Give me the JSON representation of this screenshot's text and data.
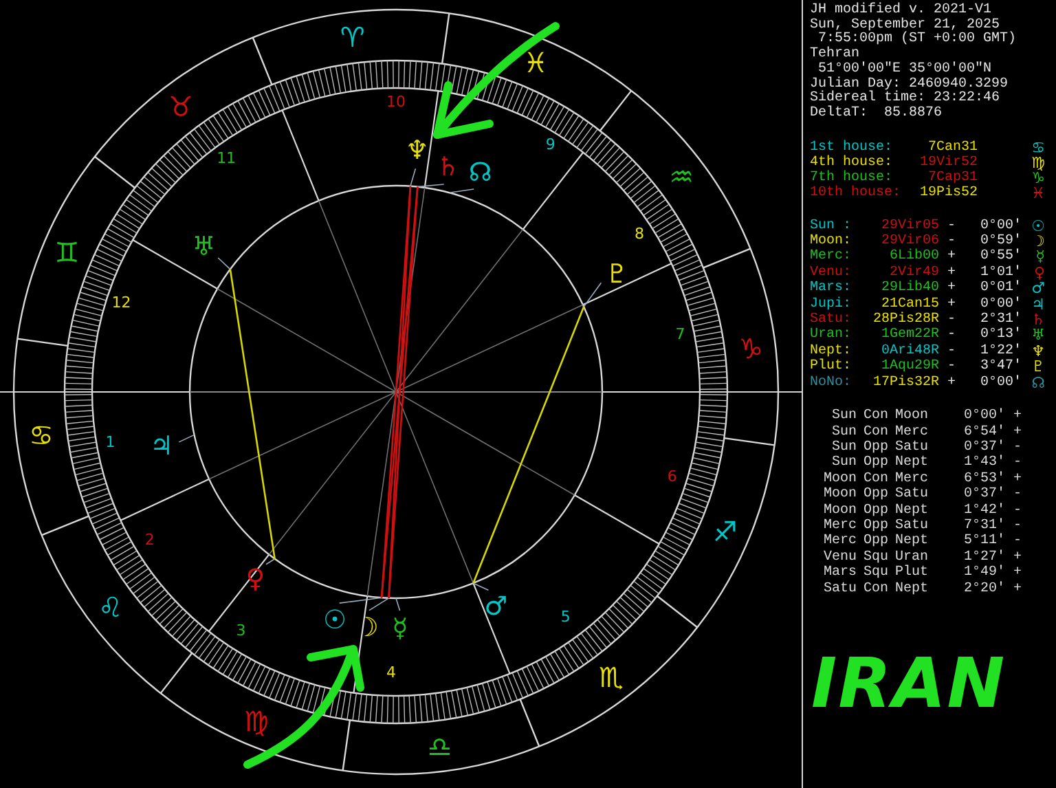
{
  "header": [
    "JH modified v. 2021-V1",
    "Sun, September 21, 2025",
    " 7:55:00pm (ST +0:00 GMT)",
    "Tehran",
    " 51°00'00\"E 35°00'00\"N",
    "Julian Day: 2460940.3299",
    "Sidereal time: 23:22:46",
    "DeltaT:  85.8876"
  ],
  "houses": [
    {
      "label": "1st house:",
      "position": {
        "text": "7Can31",
        "color": "#e8e000"
      },
      "glyph": "♋",
      "color": "#00c8c8"
    },
    {
      "label": "4th house:",
      "position": {
        "text": "19Vir52",
        "color": "#d01010"
      },
      "glyph": "♍",
      "color": "#e8e000"
    },
    {
      "label": "7th house:",
      "position": {
        "text": "7Cap31",
        "color": "#d01010"
      },
      "glyph": "♑",
      "color": "#20c020"
    },
    {
      "label": "10th house:",
      "position": {
        "text": "19Pis52",
        "color": "#e8e000"
      },
      "glyph": "♓",
      "color": "#d01010"
    }
  ],
  "planets": [
    {
      "name": "Sun :",
      "position": {
        "text": "29Vir05",
        "color": "#d01010"
      },
      "motion": "-",
      "offset": "0°00'",
      "glyph": "☉",
      "color": "#00c8c8"
    },
    {
      "name": "Moon:",
      "position": {
        "text": "29Vir06",
        "color": "#d01010"
      },
      "motion": "-",
      "offset": "0°59'",
      "glyph": "☽",
      "color": "#e8e000"
    },
    {
      "name": "Merc:",
      "position": {
        "text": "6Lib00",
        "color": "#20c020"
      },
      "motion": "+",
      "offset": "0°55'",
      "glyph": "☿",
      "color": "#20c020"
    },
    {
      "name": "Venu:",
      "position": {
        "text": "2Vir49",
        "color": "#d01010"
      },
      "motion": "+",
      "offset": "1°01'",
      "glyph": "♀",
      "color": "#d01010"
    },
    {
      "name": "Mars:",
      "position": {
        "text": "29Lib40",
        "color": "#20c020"
      },
      "motion": "+",
      "offset": "0°01'",
      "glyph": "♂",
      "color": "#00c8c8"
    },
    {
      "name": "Jupi:",
      "position": {
        "text": "21Can15",
        "color": "#e8e000"
      },
      "motion": "+",
      "offset": "0°00'",
      "glyph": "♃",
      "color": "#00c8c8"
    },
    {
      "name": "Satu:",
      "position": {
        "text": "28Pis28R",
        "color": "#e8e000"
      },
      "motion": "-",
      "offset": "2°31'",
      "glyph": "♄",
      "color": "#d01010"
    },
    {
      "name": "Uran:",
      "position": {
        "text": "1Gem22R",
        "color": "#20c020"
      },
      "motion": "-",
      "offset": "0°13'",
      "glyph": "♅",
      "color": "#20c020"
    },
    {
      "name": "Nept:",
      "position": {
        "text": "0Ari48R",
        "color": "#00c8c8"
      },
      "motion": "-",
      "offset": "1°22'",
      "glyph": "♆",
      "color": "#e8e000"
    },
    {
      "name": "Plut:",
      "position": {
        "text": "1Aqu29R",
        "color": "#20c020"
      },
      "motion": "-",
      "offset": "3°47'",
      "glyph": "♇",
      "color": "#e8e000"
    },
    {
      "name": "NoNo:",
      "position": {
        "text": "17Pis32R",
        "color": "#e8e000"
      },
      "motion": "+",
      "offset": "0°00'",
      "glyph": "☊",
      "color": "#2f8f9f"
    }
  ],
  "aspects": [
    {
      "first": "Sun",
      "type": "Con",
      "second": "Moon",
      "orb": "0°00'",
      "sign": "+"
    },
    {
      "first": "Sun",
      "type": "Con",
      "second": "Merc",
      "orb": "6°54'",
      "sign": "+"
    },
    {
      "first": "Sun",
      "type": "Opp",
      "second": "Satu",
      "orb": "0°37'",
      "sign": "-"
    },
    {
      "first": "Sun",
      "type": "Opp",
      "second": "Nept",
      "orb": "1°43'",
      "sign": "-"
    },
    {
      "first": "Moon",
      "type": "Con",
      "second": "Merc",
      "orb": "6°53'",
      "sign": "+"
    },
    {
      "first": "Moon",
      "type": "Opp",
      "second": "Satu",
      "orb": "0°37'",
      "sign": "-"
    },
    {
      "first": "Moon",
      "type": "Opp",
      "second": "Nept",
      "orb": "1°42'",
      "sign": "-"
    },
    {
      "first": "Merc",
      "type": "Opp",
      "second": "Satu",
      "orb": "7°31'",
      "sign": "-"
    },
    {
      "first": "Merc",
      "type": "Opp",
      "second": "Nept",
      "orb": "5°11'",
      "sign": "-"
    },
    {
      "first": "Venu",
      "type": "Squ",
      "second": "Uran",
      "orb": "1°27'",
      "sign": "+"
    },
    {
      "first": "Mars",
      "type": "Squ",
      "second": "Plut",
      "orb": "1°49'",
      "sign": "+"
    },
    {
      "first": "Satu",
      "type": "Con",
      "second": "Nept",
      "orb": "2°20'",
      "sign": "+"
    }
  ],
  "wheel": {
    "signs": [
      {
        "glyph": "♈",
        "color": "#00c8c8"
      },
      {
        "glyph": "♉",
        "color": "#d01010"
      },
      {
        "glyph": "♊",
        "color": "#20c020"
      },
      {
        "glyph": "♋",
        "color": "#e8e000"
      },
      {
        "glyph": "♌",
        "color": "#00c8c8"
      },
      {
        "glyph": "♍",
        "color": "#d01010"
      },
      {
        "glyph": "♎",
        "color": "#20c020"
      },
      {
        "glyph": "♏",
        "color": "#e8e000"
      },
      {
        "glyph": "♐",
        "color": "#00c8c8"
      },
      {
        "glyph": "♑",
        "color": "#d01010"
      },
      {
        "glyph": "♒",
        "color": "#20c020"
      },
      {
        "glyph": "♓",
        "color": "#e8e000"
      }
    ],
    "houses": [
      {
        "number": "1",
        "color": "#00c8c8"
      },
      {
        "number": "2",
        "color": "#d01010"
      },
      {
        "number": "3",
        "color": "#20c020"
      },
      {
        "number": "4",
        "color": "#e8e000"
      },
      {
        "number": "5",
        "color": "#00c8c8"
      },
      {
        "number": "6",
        "color": "#d01010"
      },
      {
        "number": "7",
        "color": "#20c020"
      },
      {
        "number": "8",
        "color": "#e8e000"
      },
      {
        "number": "9",
        "color": "#00c8c8"
      },
      {
        "number": "10",
        "color": "#d01010"
      },
      {
        "number": "11",
        "color": "#20c020"
      },
      {
        "number": "12",
        "color": "#e8e000"
      }
    ],
    "planets": [
      {
        "glyph": "☉",
        "color": "#00c8c8"
      },
      {
        "glyph": "☽",
        "color": "#e8e000"
      },
      {
        "glyph": "☿",
        "color": "#20c020"
      },
      {
        "glyph": "♀",
        "color": "#d01010"
      },
      {
        "glyph": "♂",
        "color": "#00c8c8"
      },
      {
        "glyph": "♃",
        "color": "#00c8c8"
      },
      {
        "glyph": "♄",
        "color": "#d01010"
      },
      {
        "glyph": "♅",
        "color": "#20c020"
      },
      {
        "glyph": "♆",
        "color": "#e8e000"
      },
      {
        "glyph": "♇",
        "color": "#e8e000"
      },
      {
        "glyph": "☊",
        "color": "#00c8c8"
      }
    ]
  },
  "annotation": {
    "text": "IRAN"
  }
}
